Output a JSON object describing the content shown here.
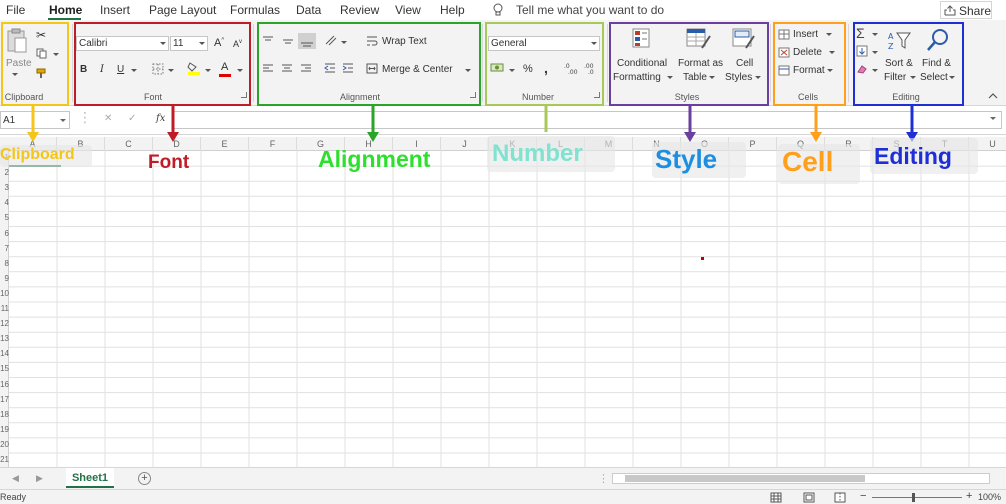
{
  "menu": {
    "tabs": [
      {
        "label": "File"
      },
      {
        "label": "Home"
      },
      {
        "label": "Insert"
      },
      {
        "label": "Page Layout"
      },
      {
        "label": "Formulas"
      },
      {
        "label": "Data"
      },
      {
        "label": "Review"
      },
      {
        "label": "View"
      },
      {
        "label": "Help"
      }
    ],
    "tell_me": "Tell me what you want to do",
    "share": "Share"
  },
  "ribbon": {
    "clipboard": {
      "label": "Clipboard",
      "paste": "Paste"
    },
    "font": {
      "label": "Font",
      "font_name": "Calibri",
      "font_size": "11",
      "bold": "B",
      "italic": "I",
      "underline": "U",
      "font_color_glyph": "A",
      "grow_glyph": "A",
      "shrink_glyph": "A"
    },
    "alignment": {
      "label": "Alignment",
      "wrap_text": "Wrap Text",
      "merge_center": "Merge & Center"
    },
    "number": {
      "label": "Number",
      "format": "General",
      "percent": "%",
      "comma": ","
    },
    "styles": {
      "label": "Styles",
      "conditional_1": "Conditional",
      "conditional_2": "Formatting",
      "format_table_1": "Format as",
      "format_table_2": "Table",
      "cell_styles_1": "Cell",
      "cell_styles_2": "Styles"
    },
    "cells": {
      "label": "Cells",
      "insert": "Insert",
      "delete": "Delete",
      "format": "Format"
    },
    "editing": {
      "label": "Editing",
      "sort_1": "Sort &",
      "sort_2": "Filter",
      "find_1": "Find &",
      "find_2": "Select"
    }
  },
  "formula_bar": {
    "name_box": "A1",
    "fx": "fx",
    "cancel_glyph": "✕",
    "enter_glyph": "✓",
    "value": ""
  },
  "grid": {
    "columns": [
      "A",
      "B",
      "C",
      "D",
      "E",
      "F",
      "G",
      "H",
      "I",
      "J",
      "K",
      "L",
      "M",
      "N",
      "O",
      "P",
      "Q",
      "R",
      "S",
      "T",
      "U"
    ],
    "rows": [
      "1",
      "2",
      "3",
      "4",
      "5",
      "6",
      "7",
      "8",
      "9",
      "10",
      "11",
      "12",
      "13",
      "14",
      "15",
      "16",
      "17",
      "18",
      "19",
      "20",
      "21"
    ]
  },
  "annotations": {
    "clipboard": "Clipboard",
    "font": "Font",
    "alignment": "Alignment",
    "number": "Number",
    "style": "Style",
    "cell": "Cell",
    "editing": "Editing"
  },
  "colors": {
    "clipboard": "#f5c518",
    "font": "#c01c28",
    "alignment": "#2aa52a",
    "number": "#a8c85a",
    "styles": "#6b3fa0",
    "cells": "#ff9f1c",
    "editing": "#1f2fd6",
    "excel_green": "#217346"
  },
  "sheets": {
    "active": "Sheet1",
    "add_glyph": "+",
    "prev_glyph": "◀",
    "next_glyph": "▶"
  },
  "status": {
    "text": "Ready",
    "zoom": "100%"
  }
}
